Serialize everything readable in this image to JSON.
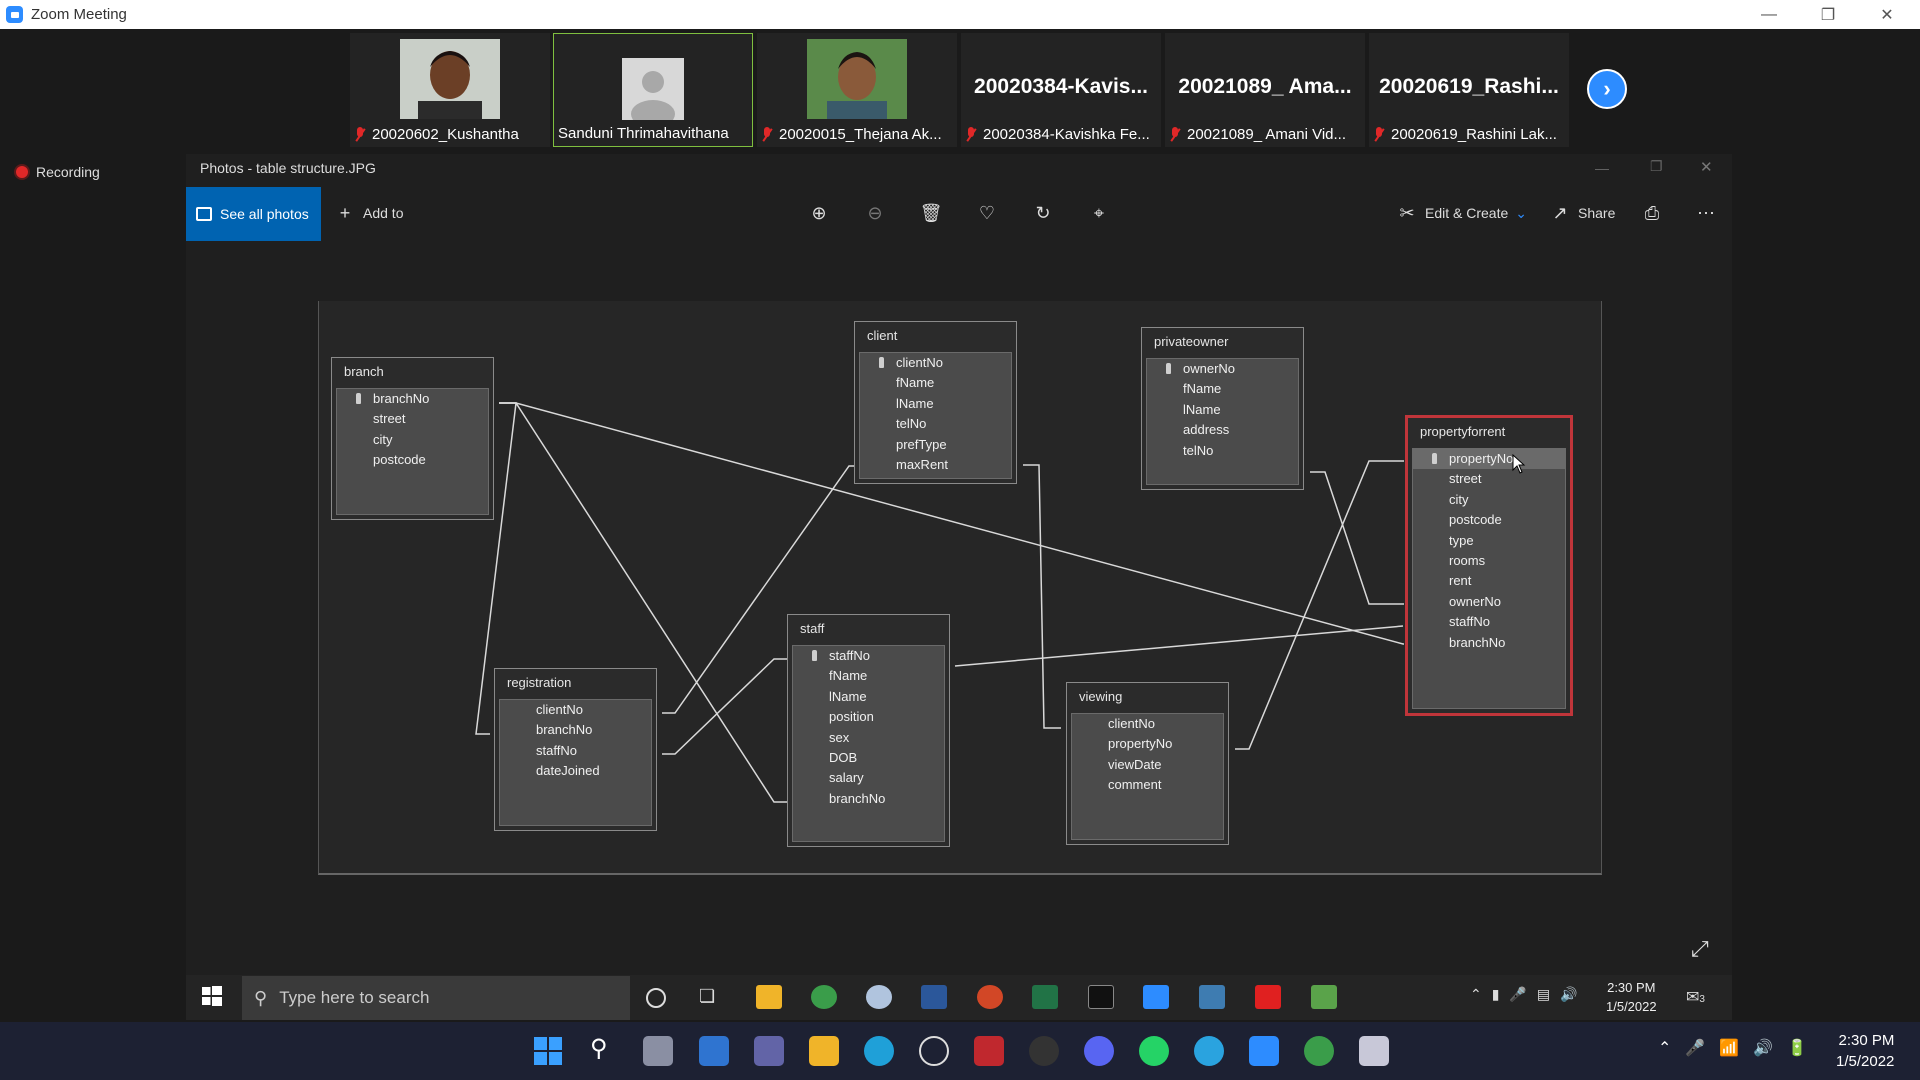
{
  "zoom": {
    "title": "Zoom Meeting",
    "recording_label": "Recording",
    "participants": [
      {
        "big": "",
        "label": "20020602_Kushantha",
        "muted": true
      },
      {
        "big": "",
        "label": "Sanduni Thrimahavithana",
        "muted": false
      },
      {
        "big": "",
        "label": "20020015_Thejana Ak...",
        "muted": true
      },
      {
        "big": "20020384-Kavis...",
        "label": "20020384-Kavishka Fe...",
        "muted": true
      },
      {
        "big": "20021089_ Ama...",
        "label": "20021089_ Amani Vid...",
        "muted": true
      },
      {
        "big": "20020619_Rashi...",
        "label": "20020619_Rashini Lak...",
        "muted": true
      }
    ]
  },
  "photos": {
    "window_title": "Photos - table structure.JPG",
    "see_all": "See all photos",
    "add_to": "Add to",
    "edit_create": "Edit & Create",
    "share": "Share"
  },
  "diagram": {
    "tables": [
      {
        "name": "branch",
        "fields": [
          "branchNo",
          "street",
          "city",
          "postcode"
        ]
      },
      {
        "name": "client",
        "fields": [
          "clientNo",
          "fName",
          "lName",
          "telNo",
          "prefType",
          "maxRent"
        ]
      },
      {
        "name": "privateowner",
        "fields": [
          "ownerNo",
          "fName",
          "lName",
          "address",
          "telNo"
        ]
      },
      {
        "name": "propertyforrent",
        "fields": [
          "propertyNo",
          "street",
          "city",
          "postcode",
          "type",
          "rooms",
          "rent",
          "ownerNo",
          "staffNo",
          "branchNo"
        ]
      },
      {
        "name": "registration",
        "fields": [
          "clientNo",
          "branchNo",
          "staffNo",
          "dateJoined"
        ]
      },
      {
        "name": "staff",
        "fields": [
          "staffNo",
          "fName",
          "lName",
          "position",
          "sex",
          "DOB",
          "salary",
          "branchNo"
        ]
      },
      {
        "name": "viewing",
        "fields": [
          "clientNo",
          "propertyNo",
          "viewDate",
          "comment"
        ]
      }
    ]
  },
  "remote_taskbar": {
    "search_placeholder": "Type here to search",
    "time": "2:30 PM",
    "date": "1/5/2022",
    "notification_count": "3"
  },
  "taskbar": {
    "time": "2:30 PM",
    "date": "1/5/2022"
  }
}
